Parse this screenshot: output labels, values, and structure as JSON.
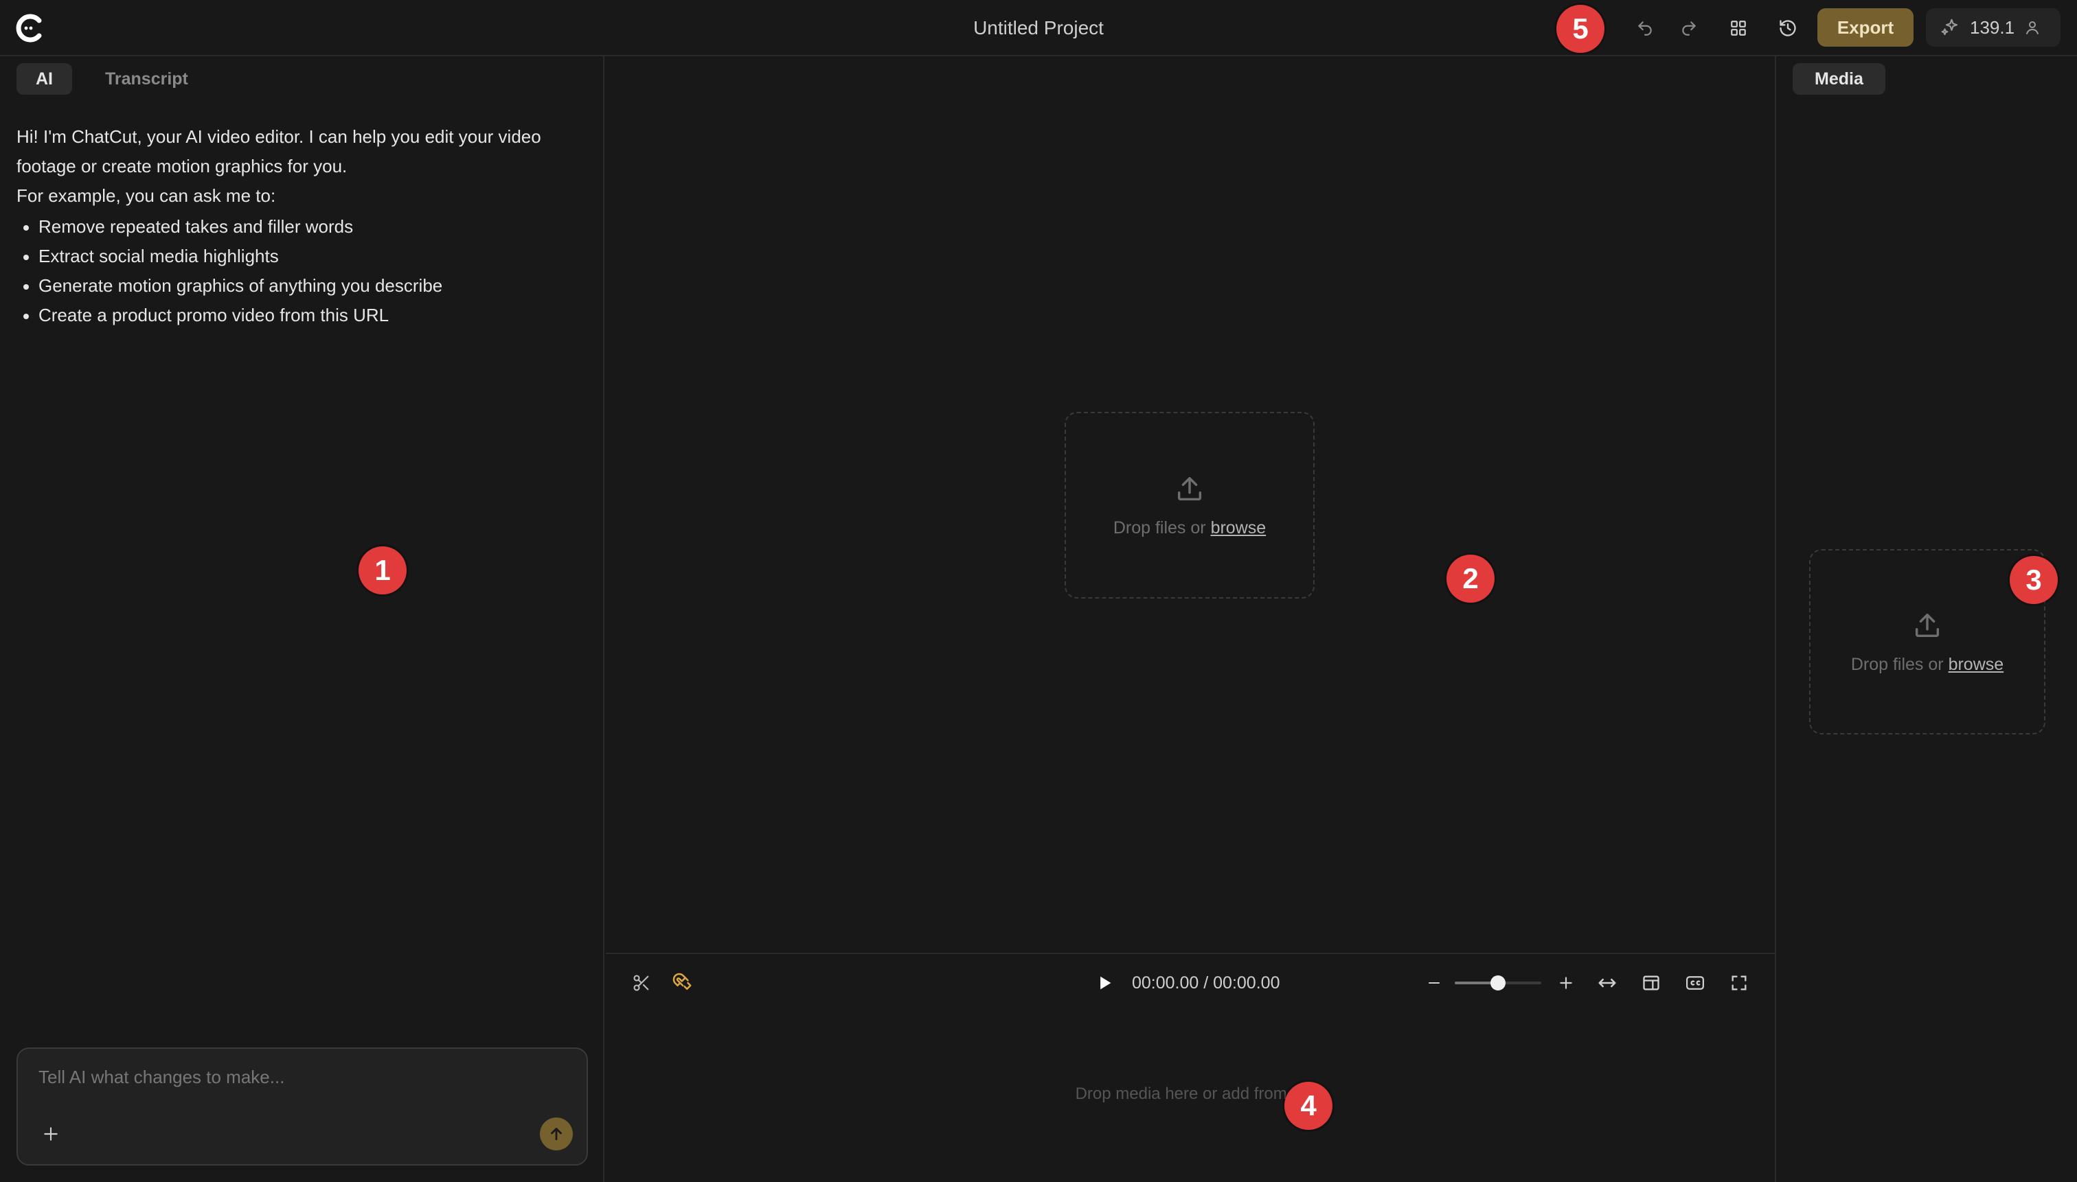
{
  "header": {
    "title": "Untitled Project",
    "export_label": "Export",
    "credits": "139.1",
    "icons": [
      "chatcut-logo-icon",
      "undo-icon",
      "redo-icon",
      "grid-icon",
      "history-icon",
      "sparkle-icon",
      "user-icon"
    ]
  },
  "left": {
    "tabs": [
      {
        "label": "AI",
        "active": true
      },
      {
        "label": "Transcript",
        "active": false
      }
    ],
    "intro": "Hi! I'm ChatCut, your AI video editor. I can help you edit your video footage or create motion graphics for you.",
    "example_lead": "For example, you can ask me to:",
    "examples": [
      "Remove repeated takes and filler words",
      "Extract social media highlights",
      "Generate motion graphics of anything you describe",
      "Create a product promo video from this URL"
    ],
    "input_placeholder": "Tell AI what changes to make..."
  },
  "preview": {
    "drop_text": "Drop files or ",
    "browse": "browse"
  },
  "timeline": {
    "timecode": "00:00.00 / 00:00.00",
    "zoom_level": 0.5,
    "empty_text": "Drop media here or add from M"
  },
  "media": {
    "tab_label": "Media",
    "drop_text": "Drop files or ",
    "browse": "browse"
  },
  "badges": [
    "1",
    "2",
    "3",
    "4",
    "5"
  ],
  "colors": {
    "accent": "#75602e",
    "badge": "#e23b3b",
    "background": "#181818"
  }
}
